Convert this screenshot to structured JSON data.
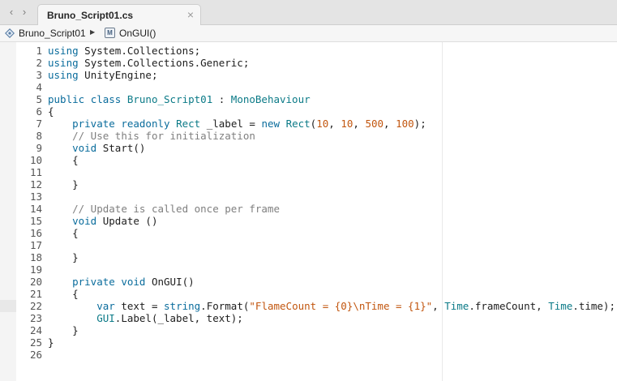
{
  "tabbar": {
    "back_glyph": "‹",
    "forward_glyph": "›",
    "active_tab": {
      "title": "Bruno_Script01.cs",
      "close_glyph": "×"
    }
  },
  "breadcrumb": {
    "items": [
      {
        "label": "Bruno_Script01",
        "icon": "class-icon"
      },
      {
        "label": "OnGUI()",
        "icon": "method-icon"
      }
    ],
    "separator_glyph": "▶",
    "method_icon_glyph": "M"
  },
  "editor": {
    "current_line": 22,
    "colors": {
      "keyword": "#0a6c9c",
      "type": "#0b7a87",
      "comment": "#7f7f7f",
      "literal": "#c2560f"
    },
    "lines": [
      {
        "n": "1",
        "tokens": [
          [
            "kw",
            "using"
          ],
          [
            "txt",
            " System.Collections;"
          ]
        ]
      },
      {
        "n": "2",
        "tokens": [
          [
            "kw",
            "using"
          ],
          [
            "txt",
            " System.Collections.Generic;"
          ]
        ]
      },
      {
        "n": "3",
        "tokens": [
          [
            "kw",
            "using"
          ],
          [
            "txt",
            " UnityEngine;"
          ]
        ]
      },
      {
        "n": "4",
        "tokens": []
      },
      {
        "n": "5",
        "tokens": [
          [
            "kw",
            "public"
          ],
          [
            "txt",
            " "
          ],
          [
            "kw",
            "class"
          ],
          [
            "txt",
            " "
          ],
          [
            "type",
            "Bruno_Script01"
          ],
          [
            "txt",
            " : "
          ],
          [
            "type",
            "MonoBehaviour"
          ]
        ]
      },
      {
        "n": "6",
        "tokens": [
          [
            "txt",
            "{"
          ]
        ]
      },
      {
        "n": "7",
        "tokens": [
          [
            "txt",
            "    "
          ],
          [
            "kw",
            "private"
          ],
          [
            "txt",
            " "
          ],
          [
            "kw",
            "readonly"
          ],
          [
            "txt",
            " "
          ],
          [
            "type",
            "Rect"
          ],
          [
            "txt",
            " _label = "
          ],
          [
            "kw",
            "new"
          ],
          [
            "txt",
            " "
          ],
          [
            "type",
            "Rect"
          ],
          [
            "txt",
            "("
          ],
          [
            "num",
            "10"
          ],
          [
            "txt",
            ", "
          ],
          [
            "num",
            "10"
          ],
          [
            "txt",
            ", "
          ],
          [
            "num",
            "500"
          ],
          [
            "txt",
            ", "
          ],
          [
            "num",
            "100"
          ],
          [
            "txt",
            ");"
          ]
        ]
      },
      {
        "n": "8",
        "tokens": [
          [
            "txt",
            "    "
          ],
          [
            "cm",
            "// Use this for initialization"
          ]
        ]
      },
      {
        "n": "9",
        "tokens": [
          [
            "txt",
            "    "
          ],
          [
            "kw",
            "void"
          ],
          [
            "txt",
            " Start()"
          ]
        ]
      },
      {
        "n": "10",
        "tokens": [
          [
            "txt",
            "    {"
          ]
        ]
      },
      {
        "n": "11",
        "tokens": []
      },
      {
        "n": "12",
        "tokens": [
          [
            "txt",
            "    }"
          ]
        ]
      },
      {
        "n": "13",
        "tokens": []
      },
      {
        "n": "14",
        "tokens": [
          [
            "txt",
            "    "
          ],
          [
            "cm",
            "// Update is called once per frame"
          ]
        ]
      },
      {
        "n": "15",
        "tokens": [
          [
            "txt",
            "    "
          ],
          [
            "kw",
            "void"
          ],
          [
            "txt",
            " Update ()"
          ]
        ]
      },
      {
        "n": "16",
        "tokens": [
          [
            "txt",
            "    {"
          ]
        ]
      },
      {
        "n": "17",
        "tokens": []
      },
      {
        "n": "18",
        "tokens": [
          [
            "txt",
            "    }"
          ]
        ]
      },
      {
        "n": "19",
        "tokens": []
      },
      {
        "n": "20",
        "tokens": [
          [
            "txt",
            "    "
          ],
          [
            "kw",
            "private"
          ],
          [
            "txt",
            " "
          ],
          [
            "kw",
            "void"
          ],
          [
            "txt",
            " OnGUI()"
          ]
        ]
      },
      {
        "n": "21",
        "tokens": [
          [
            "txt",
            "    {"
          ]
        ]
      },
      {
        "n": "22",
        "tokens": [
          [
            "txt",
            "        "
          ],
          [
            "kw",
            "var"
          ],
          [
            "txt",
            " text = "
          ],
          [
            "kw",
            "string"
          ],
          [
            "txt",
            ".Format("
          ],
          [
            "str",
            "\"FlameCount = {0}\\nTime = {1}\""
          ],
          [
            "txt",
            ", "
          ],
          [
            "type",
            "Time"
          ],
          [
            "txt",
            ".frameCount, "
          ],
          [
            "type",
            "Time"
          ],
          [
            "txt",
            ".time);"
          ]
        ]
      },
      {
        "n": "23",
        "tokens": [
          [
            "txt",
            "        "
          ],
          [
            "type",
            "GUI"
          ],
          [
            "txt",
            ".Label(_label, text);"
          ]
        ]
      },
      {
        "n": "24",
        "tokens": [
          [
            "txt",
            "    }"
          ]
        ]
      },
      {
        "n": "25",
        "tokens": [
          [
            "txt",
            "}"
          ]
        ]
      },
      {
        "n": "26",
        "tokens": []
      }
    ]
  }
}
